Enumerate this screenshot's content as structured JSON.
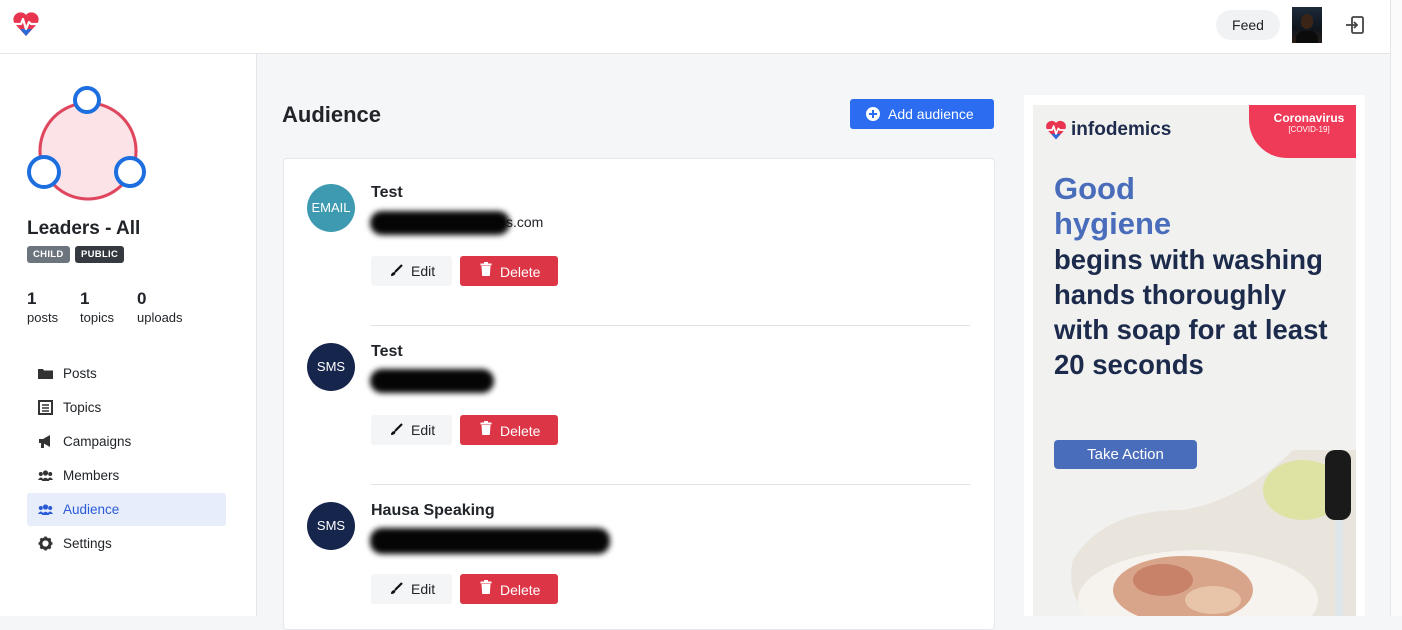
{
  "header": {
    "feed_label": "Feed",
    "brand_color": "#e8344e",
    "brand_accent": "#2d6ad9"
  },
  "group": {
    "name": "Leaders - All",
    "badges": [
      "CHILD",
      "PUBLIC"
    ],
    "stats": [
      {
        "value": "1",
        "label": "posts"
      },
      {
        "value": "1",
        "label": "topics"
      },
      {
        "value": "0",
        "label": "uploads"
      }
    ]
  },
  "sidebar": {
    "items": [
      {
        "label": "Posts",
        "icon": "folder-icon"
      },
      {
        "label": "Topics",
        "icon": "list-icon"
      },
      {
        "label": "Campaigns",
        "icon": "megaphone-icon"
      },
      {
        "label": "Members",
        "icon": "users-icon"
      },
      {
        "label": "Audience",
        "icon": "users-icon",
        "active": true
      },
      {
        "label": "Settings",
        "icon": "gear-icon"
      }
    ]
  },
  "main": {
    "title": "Audience",
    "add_label": "Add audience",
    "entries": [
      {
        "type": "EMAIL",
        "name": "Test",
        "contact_visible": "s.com",
        "contact_redacted": true
      },
      {
        "type": "SMS",
        "name": "Test",
        "contact_visible": "",
        "contact_redacted": true
      },
      {
        "type": "SMS",
        "name": "Hausa Speaking",
        "contact_visible": "",
        "contact_redacted": true
      }
    ],
    "edit_label": "Edit",
    "delete_label": "Delete"
  },
  "ad": {
    "brand": "infodemics",
    "tag_title": "Coronavirus",
    "tag_sub": "[COVID-19]",
    "headline_line1": "Good",
    "headline_line2": "hygiene",
    "body": "begins with washing hands thoroughly with soap for at least 20 seconds",
    "cta": "Take Action"
  }
}
